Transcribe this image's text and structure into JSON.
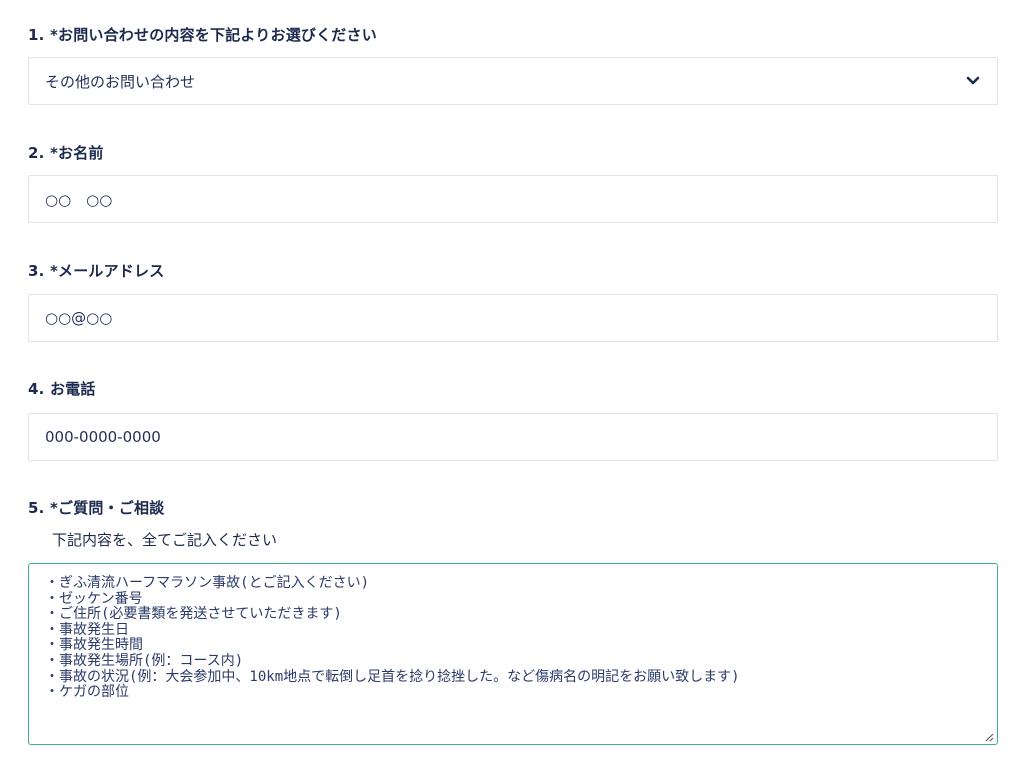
{
  "q1": {
    "label": "1. *お問い合わせの内容を下記よりお選びください",
    "selected": "その他のお問い合わせ",
    "icon": "chevron-down-icon"
  },
  "q2": {
    "label": "2. *お名前",
    "value": "○○　○○"
  },
  "q3": {
    "label": "3. *メールアドレス",
    "value": "○○@○○"
  },
  "q4": {
    "label": "4. お電話",
    "value": "000-0000-0000"
  },
  "q5": {
    "label": "5. *ご質問・ご相談",
    "hint": "下記内容を、全てご記入ください",
    "lines": [
      "・ぎふ清流ハーフマラソン事故(とご記入ください)",
      "・ゼッケン番号",
      "・ご住所(必要書類を発送させていただきます)",
      "・事故発生日",
      "・事故発生時間",
      "・事故発生場所(例：コース内)",
      "・事故の状況(例：大会参加中、10km地点で転倒し足首を捻り捻挫した。など傷病名の明記をお願い致します)",
      "・ケガの部位"
    ]
  },
  "colors": {
    "label": "#1b2a4d",
    "border": "#dfe3ea",
    "focus_border": "#3fb28a"
  }
}
